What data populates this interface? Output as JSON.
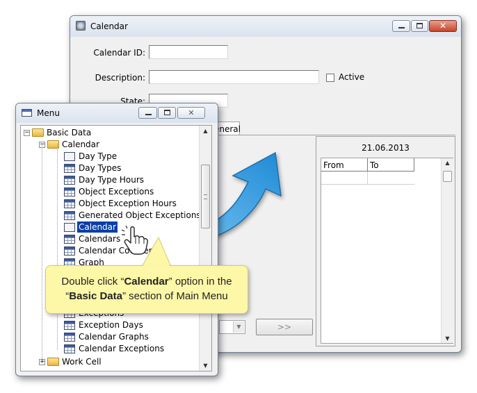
{
  "calendar_window": {
    "title": "Calendar",
    "fields": {
      "calendar_id_label": "Calendar ID:",
      "description_label": "Description:",
      "state_label": "State:",
      "active_label": "Active"
    },
    "tab_label": "eneral",
    "date_header": "21.06.2013",
    "columns": [
      "From",
      "To"
    ],
    "next_button": ">>"
  },
  "menu_window": {
    "title": "Menu",
    "tree": {
      "basic_data": "Basic Data",
      "calendar_folder": "Calendar",
      "items": [
        "Day Type",
        "Day Types",
        "Day Type Hours",
        "Object Exceptions",
        "Object Exception Hours",
        "Generated Object Exceptions",
        "Calendar",
        "Calendars",
        "Calendar Counters",
        "Graph"
      ],
      "lower_items": [
        "Exceptions",
        "Exception Days",
        "Calendar Graphs",
        "Calendar Exceptions"
      ],
      "work_cell": "Work Cell"
    }
  },
  "callout": {
    "line1_prefix": "Double click “",
    "line1_bold": "Calendar",
    "line1_suffix": "” option in the",
    "line2_prefix": "“",
    "line2_bold": "Basic Data",
    "line2_suffix": "” section of Main Menu"
  },
  "colors": {
    "selection": "#0a3ea8",
    "arrow": "#2e9ae0",
    "callout_bg": "#fdf7a8"
  }
}
